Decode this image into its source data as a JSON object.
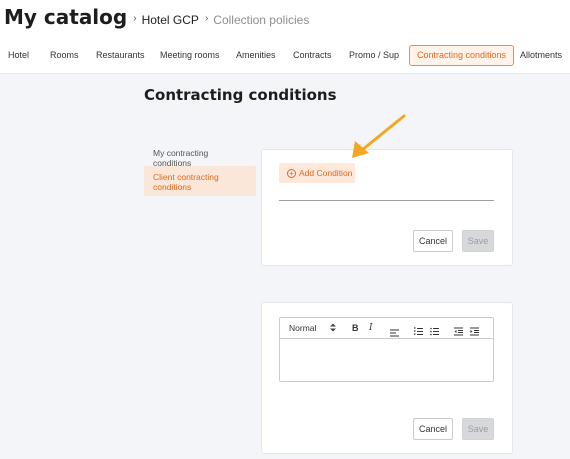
{
  "breadcrumb": {
    "title": "My catalog",
    "hotel": "Hotel GCP",
    "current": "Collection policies",
    "separator": "›"
  },
  "tabs": [
    {
      "label": "Hotel"
    },
    {
      "label": "Rooms"
    },
    {
      "label": "Restaurants"
    },
    {
      "label": "Meeting rooms"
    },
    {
      "label": "Amenities"
    },
    {
      "label": "Contracts"
    },
    {
      "label": "Promo / Sup"
    },
    {
      "label": "Contracting conditions",
      "active": true
    },
    {
      "label": "Allotments"
    }
  ],
  "page_title": "Contracting conditions",
  "sidebar": {
    "items": [
      {
        "label": "My contracting conditions"
      },
      {
        "label": "Client contracting conditions",
        "active": true
      }
    ]
  },
  "condition_card": {
    "add_condition_label": "Add Condition",
    "cancel_label": "Cancel",
    "save_label": "Save"
  },
  "editor_card": {
    "format_value": "Normal",
    "bold_label": "B",
    "italic_label": "I",
    "cancel_label": "Cancel",
    "save_label": "Save"
  },
  "colors": {
    "accent": "#e2691f",
    "accent_bg": "#fde8da",
    "annotation_arrow": "#f5a623"
  },
  "icons": {
    "breadcrumb_separator": "chevron-right-icon",
    "add": "plus-circle-icon",
    "align": "align-left-icon",
    "ordered_list": "ordered-list-icon",
    "bullet_list": "bullet-list-icon",
    "outdent": "outdent-icon",
    "indent": "indent-icon",
    "annotation": "arrow-annotation-icon"
  }
}
